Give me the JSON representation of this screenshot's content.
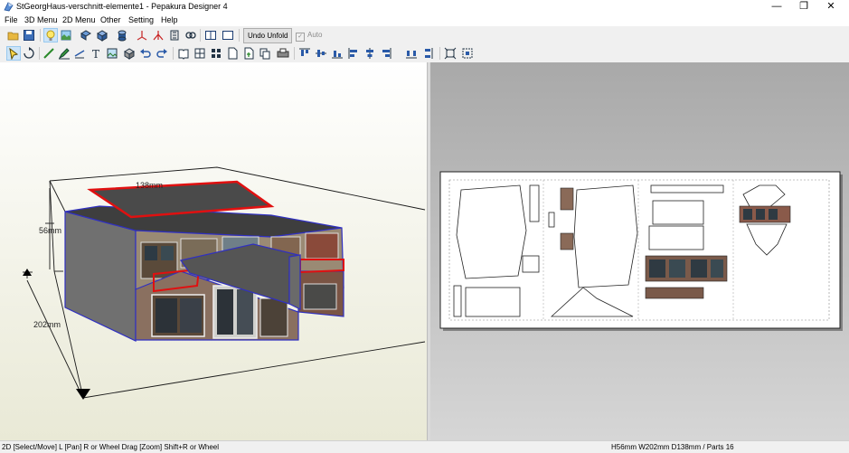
{
  "window": {
    "title": "StGeorgHaus-verschnitt-elemente1 - Pepakura Designer 4",
    "controls": [
      "minimize",
      "restore",
      "close"
    ]
  },
  "menubar": [
    "File",
    "3D Menu",
    "2D Menu",
    "Other",
    "Setting",
    "Help"
  ],
  "toolbar1": {
    "icons": [
      "open-icon",
      "save-icon",
      "light-icon",
      "texture-icon",
      "unfold-icon",
      "cube-icon",
      "cylinder-icon",
      "axis-icon",
      "flip-icon",
      "mirror-icon",
      "link-icon",
      "split-view-icon",
      "single-view-icon"
    ],
    "undo_unfold_label": "Undo Unfold",
    "auto_label": "Auto",
    "auto_checked": true
  },
  "toolbar2": {
    "icons": [
      "select-icon",
      "rotate-icon",
      "edit-line-icon",
      "pen-icon",
      "text-icon",
      "image-icon",
      "box-icon",
      "undo-icon",
      "redo-icon",
      "book-icon",
      "grid-icon",
      "pattern-icon",
      "page-icon",
      "page-add-icon",
      "copy-icon",
      "print-icon",
      "align-top-icon",
      "align-middle-icon",
      "align-bottom-icon",
      "align-left-icon",
      "align-center-icon",
      "align-right-icon",
      "fit-page-icon",
      "fit-select-icon"
    ]
  },
  "view3d": {
    "dim_width": "138mm",
    "dim_height": "56mm",
    "dim_depth": "202mm"
  },
  "status": {
    "left": "2D [Select/Move] L [Pan] R or Wheel Drag [Zoom] Shift+R or Wheel",
    "right": "H56mm W202mm D138mm / Parts 16"
  }
}
